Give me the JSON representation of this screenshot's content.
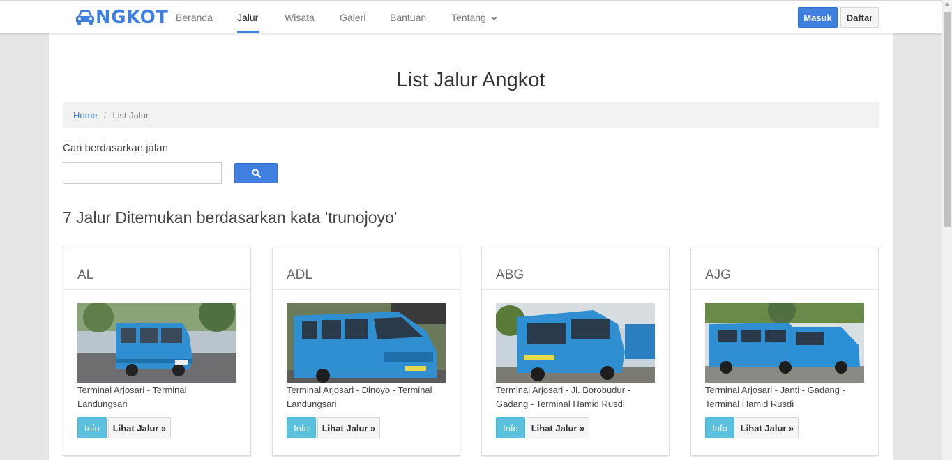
{
  "brand": {
    "name": "NGKOT",
    "color": "#3f7fe0",
    "icon": "car-icon"
  },
  "nav": {
    "items": [
      {
        "label": "Beranda"
      },
      {
        "label": "Jalur"
      },
      {
        "label": "Wisata"
      },
      {
        "label": "Galeri"
      },
      {
        "label": "Bantuan"
      },
      {
        "label": "Tentang"
      }
    ],
    "active": "Jalur",
    "dropdown_icon": "chevron-down-icon",
    "login_label": "Masuk",
    "register_label": "Daftar"
  },
  "page": {
    "title": "List Jalur Angkot",
    "breadcrumb": {
      "home": "Home",
      "separator": "/",
      "current": "List Jalur"
    }
  },
  "search": {
    "label": "Cari berdasarkan jalan",
    "value": "",
    "button_icon": "search-icon"
  },
  "results": {
    "heading": "7 Jalur Ditemukan berdasarkan kata 'trunojoyo'",
    "cards": [
      {
        "code": "AL",
        "route": "Terminal Arjosari - Terminal Landungsari",
        "info_label": "Info",
        "view_label": "Lihat Jalur »"
      },
      {
        "code": "ADL",
        "route": "Terminal Arjosari - Dinoyo - Terminal Landungsari",
        "info_label": "Info",
        "view_label": "Lihat Jalur »"
      },
      {
        "code": "ABG",
        "route": "Terminal Arjosari - Jl. Borobudur - Gadang - Terminal Hamid Rusdi",
        "info_label": "Info",
        "view_label": "Lihat Jalur »"
      },
      {
        "code": "AJG",
        "route": "Terminal Arjosari - Janti - Gadang - Terminal Hamid Rusdi",
        "info_label": "Info",
        "view_label": "Lihat Jalur »"
      }
    ]
  },
  "colors": {
    "primary": "#3f7fe0",
    "info": "#5bc0de",
    "van": "#2f8fd0"
  }
}
